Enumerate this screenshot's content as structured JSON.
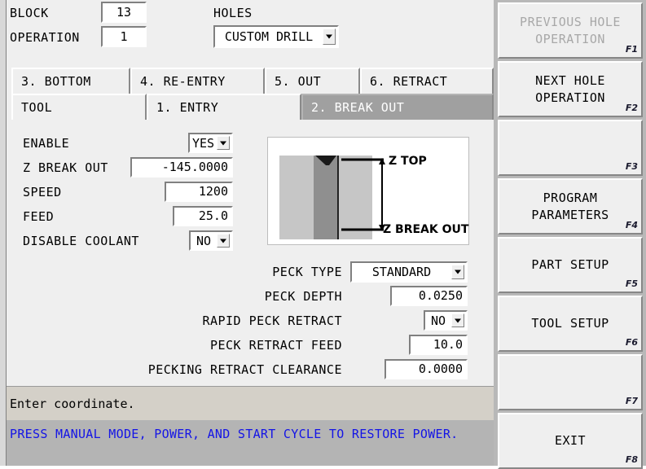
{
  "header": {
    "block_label": "BLOCK",
    "block_value": "13",
    "operation_label": "OPERATION",
    "operation_value": "1",
    "holes_label": "HOLES",
    "holes_value": "CUSTOM DRILL",
    "holes_options": [
      "CUSTOM DRILL"
    ]
  },
  "tabs": {
    "top_row": [
      {
        "label": "3. BOTTOM",
        "selected": false
      },
      {
        "label": "4. RE-ENTRY",
        "selected": false
      },
      {
        "label": "5. OUT",
        "selected": false
      },
      {
        "label": "6. RETRACT",
        "selected": false
      }
    ],
    "bottom_row": [
      {
        "label": "TOOL",
        "selected": false
      },
      {
        "label": "1. ENTRY",
        "selected": false
      },
      {
        "label": "2. BREAK OUT",
        "selected": true
      }
    ]
  },
  "form": {
    "enable_label": "ENABLE",
    "enable_value": "YES",
    "enable_options": [
      "YES",
      "NO"
    ],
    "z_break_out_label": "Z BREAK OUT",
    "z_break_out_value": "-145.0000",
    "speed_label": "SPEED",
    "speed_value": "1200",
    "feed_label": "FEED",
    "feed_value": "25.0",
    "disable_coolant_label": "DISABLE COOLANT",
    "disable_coolant_value": "NO",
    "disable_coolant_options": [
      "YES",
      "NO"
    ],
    "peck_type_label": "PECK TYPE",
    "peck_type_value": "STANDARD",
    "peck_type_options": [
      "STANDARD"
    ],
    "peck_depth_label": "PECK DEPTH",
    "peck_depth_value": "0.0250",
    "rapid_peck_retract_label": "RAPID PECK RETRACT",
    "rapid_peck_retract_value": "NO",
    "rapid_peck_retract_options": [
      "YES",
      "NO"
    ],
    "peck_retract_feed_label": "PECK RETRACT FEED",
    "peck_retract_feed_value": "10.0",
    "pecking_retract_clearance_label": "PECKING RETRACT CLEARANCE",
    "pecking_retract_clearance_value": "0.0000"
  },
  "diagram": {
    "z_top_label": "Z TOP",
    "z_break_out_label": "Z BREAK OUT"
  },
  "status": {
    "prompt": "Enter coordinate.",
    "message": "PRESS MANUAL MODE, POWER, AND START CYCLE TO RESTORE POWER."
  },
  "softkeys": [
    {
      "lines": [
        "PREVIOUS HOLE",
        "OPERATION"
      ],
      "fkey": "F1",
      "disabled": true
    },
    {
      "lines": [
        "NEXT HOLE",
        "OPERATION"
      ],
      "fkey": "F2",
      "disabled": false
    },
    {
      "lines": [],
      "fkey": "F3",
      "disabled": false
    },
    {
      "lines": [
        "PROGRAM",
        "PARAMETERS"
      ],
      "fkey": "F4",
      "disabled": false
    },
    {
      "lines": [
        "PART SETUP"
      ],
      "fkey": "F5",
      "disabled": false
    },
    {
      "lines": [
        "TOOL SETUP"
      ],
      "fkey": "F6",
      "disabled": false
    },
    {
      "lines": [],
      "fkey": "F7",
      "disabled": false
    },
    {
      "lines": [
        "EXIT"
      ],
      "fkey": "F8",
      "disabled": false
    }
  ],
  "colors": {
    "panel_bg": "#efefef",
    "selected_tab": "#a0a0a0",
    "message_text": "#1414e6",
    "softkey_bg": "#b8b8b8",
    "disabled_text": "#a8a8a8"
  }
}
